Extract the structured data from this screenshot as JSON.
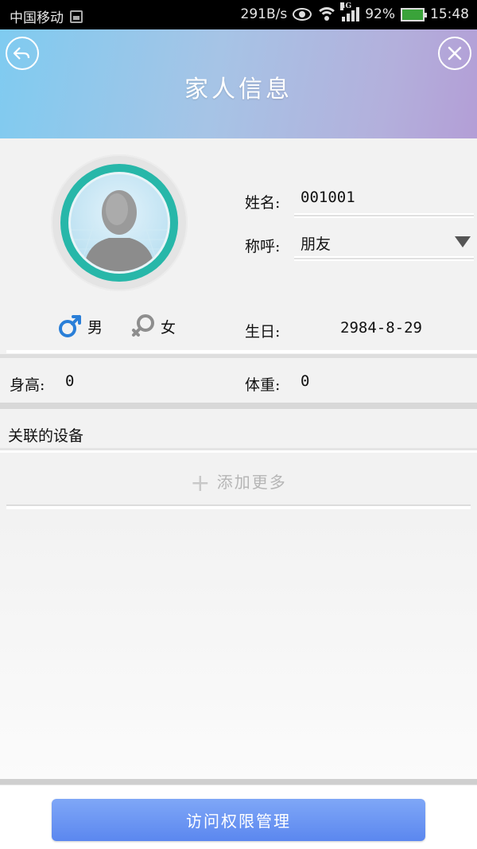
{
  "status_bar": {
    "carrier": "中国移动",
    "net_speed": "291B/s",
    "network_type": "4G",
    "battery": "92%",
    "time": "15:48"
  },
  "header": {
    "title": "家人信息",
    "back_icon": "back-arrow-icon",
    "close_icon": "close-icon"
  },
  "profile": {
    "name_label": "姓名:",
    "name_value": "001001",
    "relation_label": "称呼:",
    "relation_value": "朋友",
    "gender_male": "男",
    "gender_female": "女",
    "birthday_label": "生日:",
    "birthday_value": "2984-8-29",
    "height_label": "身高:",
    "height_value": "0",
    "weight_label": "体重:",
    "weight_value": "0"
  },
  "devices": {
    "section_title": "关联的设备",
    "add_more": "添加更多"
  },
  "footer": {
    "access_button": "访问权限管理"
  },
  "colors": {
    "header_gradient_start": "#7fcbf0",
    "header_gradient_end": "#b39ed6",
    "avatar_ring": "#27b7a9",
    "male_icon": "#2a7fd8",
    "button": "#6a95f2"
  }
}
